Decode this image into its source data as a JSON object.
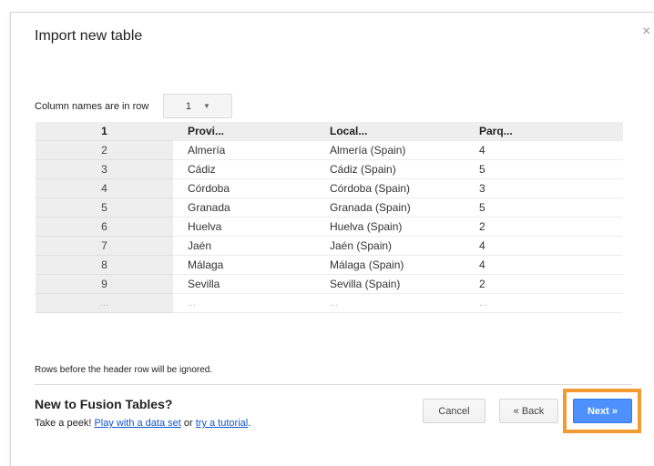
{
  "dialog": {
    "title": "Import new table",
    "close_glyph": "×"
  },
  "options": {
    "column_names_label": "Column names are in row",
    "row_value": "1",
    "dropdown_arrow": "▼"
  },
  "table": {
    "header": [
      "1",
      "Provi...",
      "Local...",
      "Parq..."
    ],
    "rows": [
      [
        "2",
        "Almería",
        "Almería (Spain)",
        "4"
      ],
      [
        "3",
        "Cádiz",
        "Cádiz (Spain)",
        "5"
      ],
      [
        "4",
        "Córdoba",
        "Córdoba (Spain)",
        "3"
      ],
      [
        "5",
        "Granada",
        "Granada (Spain)",
        "5"
      ],
      [
        "6",
        "Huelva",
        "Huelva (Spain)",
        "2"
      ],
      [
        "7",
        "Jaén",
        "Jaén (Spain)",
        "4"
      ],
      [
        "8",
        "Málaga",
        "Málaga (Spain)",
        "4"
      ],
      [
        "9",
        "Sevilla",
        "Sevilla (Spain)",
        "2"
      ]
    ],
    "more": [
      "...",
      "...",
      "...",
      "..."
    ]
  },
  "note": "Rows before the header row will be ignored.",
  "footer": {
    "heading": "New to Fusion Tables?",
    "peek_prefix": "Take a peek!",
    "link_dataset": "Play with a data set",
    "or_text": "or",
    "link_tutorial": "try a tutorial",
    "period": "."
  },
  "buttons": {
    "cancel": "Cancel",
    "back": "« Back",
    "next": "Next »"
  },
  "colors": {
    "primary_button": "#4d90fe",
    "highlight_border": "#f39b32",
    "link": "#1155cc"
  }
}
